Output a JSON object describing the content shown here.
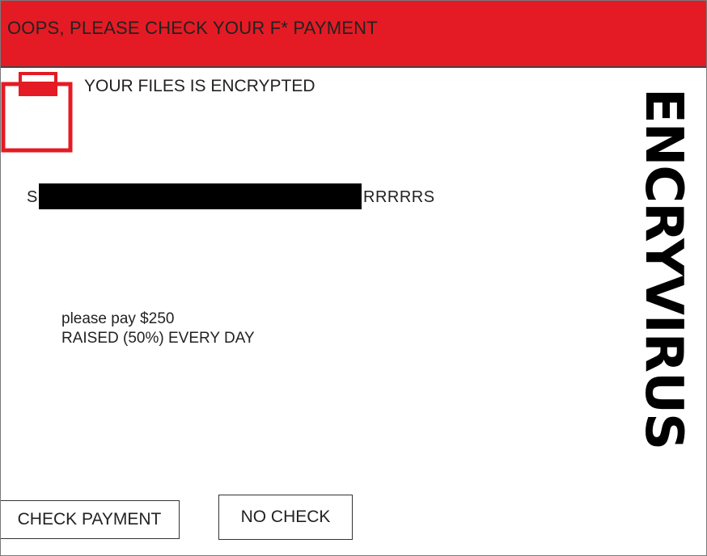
{
  "colors": {
    "title_bar": "#e41b24",
    "icon_red": "#e41b24",
    "text": "#222222"
  },
  "window": {
    "title": "OOPS, PLEASE CHECK YOUR F* PAYMENT"
  },
  "main": {
    "icon": "clipboard-icon",
    "headline": "YOUR FILES IS ENCRYPTED",
    "redacted_prefix": "S",
    "redacted_suffix": "RRRRRS",
    "price_line": "please pay $250",
    "raise_line": "RAISED (50%) EVERY DAY",
    "brand": "ENCRYVIRUS"
  },
  "buttons": {
    "check_payment": "CHECK PAYMENT",
    "no_check": "NO CHECK"
  }
}
